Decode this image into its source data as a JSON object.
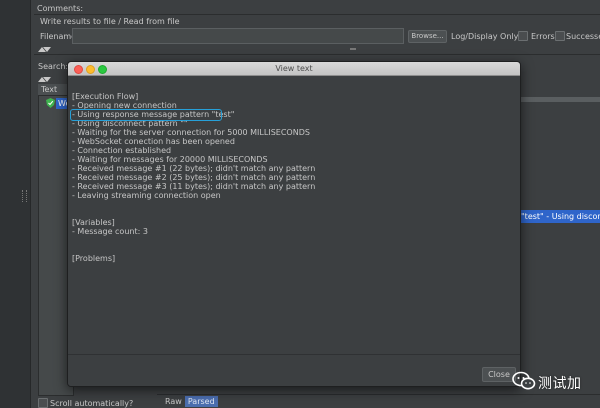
{
  "background_window": {
    "comments_label": "Comments:",
    "write_results_label": "Write results to file / Read from file",
    "filename_label": "Filename",
    "filename_value": "",
    "browse_label": "Browse...",
    "log_display_label": "Log/Display Only:",
    "errors_label": "Errors",
    "successes_label": "Successes",
    "search_label": "Search:",
    "tree_header": "Text",
    "tree_item_label": "We",
    "right_selected_text": "\"test\" - Using disconnect",
    "scroll_auto_label": "Scroll automatically?",
    "bottom_tabs": [
      {
        "label": "Raw",
        "active": false
      },
      {
        "label": "Parsed",
        "active": true
      }
    ]
  },
  "dialog": {
    "title": "View text",
    "lines": [
      "[Execution Flow]",
      " - Opening new connection",
      " - Using response message pattern \"test\"",
      " - Using disconnect pattern \"\"",
      " - Waiting for the server connection for 5000 MILLISECONDS",
      " - WebSocket conection has been opened",
      " - Connection established",
      " - Waiting for messages for 20000 MILLISECONDS",
      " - Received message #1 (22 bytes); didn't match any pattern",
      " - Received message #2 (25 bytes); didn't match any pattern",
      " - Received message #3 (11 bytes); didn't match any pattern",
      " - Leaving streaming connection open",
      "",
      "",
      "[Variables]",
      " - Message count: 3",
      "",
      "",
      "[Problems]"
    ],
    "close_label": "Close"
  },
  "watermark": {
    "text": "测试加",
    "icon": "wechat-icon"
  },
  "colors": {
    "highlight_border": "#27a0d8",
    "selection": "#2f65ca"
  }
}
